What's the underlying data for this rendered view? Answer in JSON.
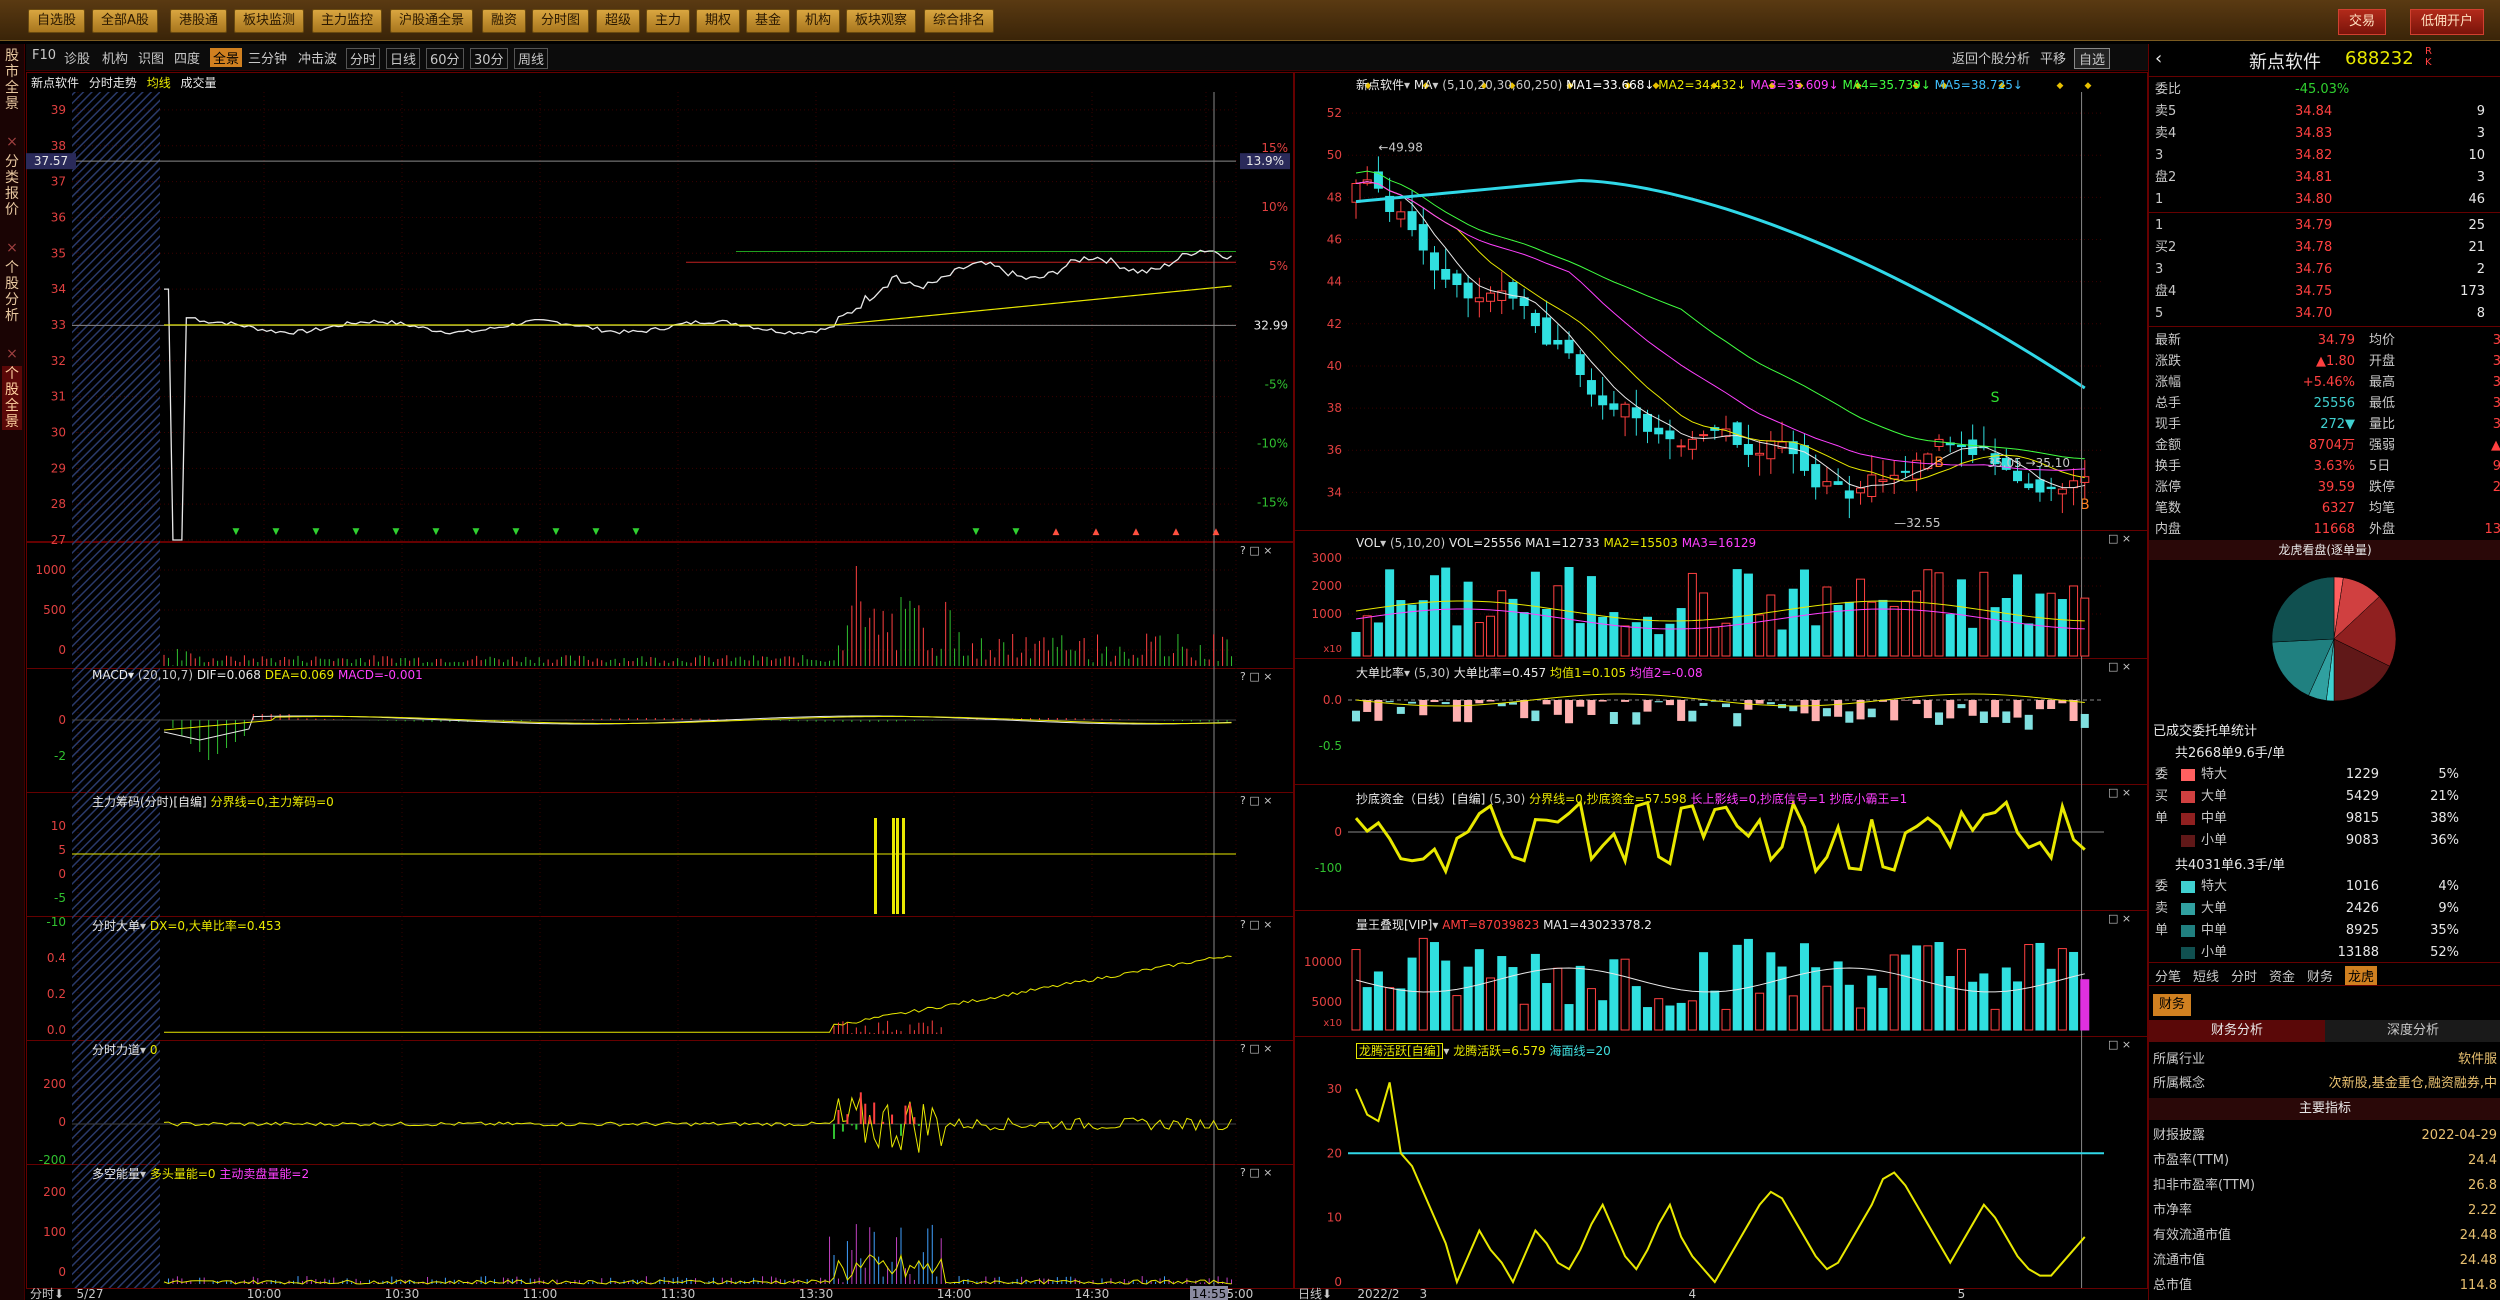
{
  "topbar": {
    "menu": [
      "自选股",
      "全部A股",
      "港股通",
      "板块监测",
      "主力监控",
      "沪股通全景",
      "融资",
      "分时图",
      "超级",
      "主力",
      "期权",
      "基金",
      "机构",
      "板块观察",
      "综合排名"
    ],
    "buttons": {
      "trade": "交易",
      "open_account": "低佣开户"
    },
    "window": [
      "–",
      "□",
      "×"
    ]
  },
  "left_tabs": [
    {
      "label": "股市全景",
      "close": "×"
    },
    {
      "label": "分类报价",
      "close": "×"
    },
    {
      "label": "个股分析",
      "close": "×"
    },
    {
      "label": "个股全景",
      "close": "×"
    }
  ],
  "toolbar": {
    "left": [
      "F10",
      "诊股",
      "机构",
      "识图",
      "四度"
    ],
    "active": "全景",
    "middle": [
      "三分钟",
      "冲击波"
    ],
    "periods": [
      "分时",
      "日线",
      "60分",
      "30分",
      "周线"
    ],
    "right": [
      "返回个股分析",
      "平移",
      "自选"
    ]
  },
  "intraday": {
    "title": {
      "name": "新点软件",
      "mode": "分时走势",
      "avg": "均线",
      "vol": "成交量"
    },
    "price_ticks": [
      "39",
      "38",
      "37",
      "36",
      "35",
      "34",
      "33",
      "32",
      "31",
      "30",
      "29",
      "28",
      "27"
    ],
    "pct_ticks": [
      "15%",
      "10%",
      "5%",
      "",
      "-5%",
      "-10%",
      "-15%"
    ],
    "current_price_label": "37.57",
    "current_pct_label": "13.9%",
    "ref_price": "32.99",
    "vol_ticks": [
      "1000",
      "500",
      "0"
    ],
    "time_ticks": [
      "5/27",
      "10:00",
      "10:30",
      "11:00",
      "11:30",
      "13:30",
      "14:00",
      "14:30",
      "14:55",
      "15:00"
    ],
    "time_label": "分时"
  },
  "macd_panel": {
    "name": "MACD",
    "params": "(20,10,7)",
    "dif": "DIF=0.068",
    "dea": "DEA=0.069",
    "macd": "MACD=-0.001",
    "ticks": [
      "0",
      "-2"
    ]
  },
  "main_chip": {
    "name": "主力筹码(分时)[自编]",
    "text": "分界线=0,主力筹码=0",
    "ticks": [
      "10",
      "5",
      "0",
      "-5",
      "-10"
    ]
  },
  "big_order": {
    "name": "分时大单",
    "text": "DX=0,大单比率=0.453",
    "ticks": [
      "0.4",
      "0.2",
      "0.0"
    ]
  },
  "force": {
    "name": "分时力道",
    "text": "0",
    "ticks": [
      "200",
      "0",
      "-200"
    ]
  },
  "energy": {
    "name": "多空能量",
    "a": "多头量能=0",
    "b": "主动卖盘量能=2",
    "ticks": [
      "200",
      "100",
      "0"
    ]
  },
  "kline": {
    "name": "新点软件",
    "ma_label": "MA",
    "params": "(5,10,20,30,60,250)",
    "ma": [
      {
        "t": "MA1=33.668",
        "c": "#ffffff"
      },
      {
        "t": "MA2=34.432",
        "c": "#e8e800"
      },
      {
        "t": "MA3=35.609",
        "c": "#ff40ff"
      },
      {
        "t": "MA4=35.739",
        "c": "#40ff40"
      },
      {
        "t": "MA5=38.725",
        "c": "#40c0ff"
      }
    ],
    "price_ticks": [
      "52",
      "50",
      "48",
      "46",
      "44",
      "42",
      "40",
      "38",
      "36",
      "34"
    ],
    "labels": {
      "high": "49.98",
      "low": "32.55",
      "mid": "35.05",
      "mid2": "35.10",
      "b1": "B",
      "s1": "S",
      "b2": "B"
    },
    "time_ticks": [
      "2022/2",
      "3",
      "4",
      "5"
    ],
    "time_label": "日线"
  },
  "vol_panel": {
    "name": "VOL",
    "params": "(5,10,20)",
    "vol": "VOL=25556",
    "ma1": "MA1=12733",
    "ma2": "MA2=15503",
    "ma3": "MA3=16129",
    "ticks": [
      "3000",
      "2000",
      "1000"
    ],
    "unit": "x10"
  },
  "big_ratio": {
    "name": "大单比率",
    "params": "(5,30)",
    "val": "大单比率=0.457",
    "m1": "均值1=0.105",
    "m2": "均值2=-0.08",
    "ticks": [
      "0.0",
      "-0.5"
    ]
  },
  "bottom_fund": {
    "name": "抄底资金（日线）[自编]",
    "params": "(5,30)",
    "text": "分界线=0,抄底资金=57.598",
    "t2": "长上影线=0,抄底信号=1",
    "t3": "抄底小霸王=1",
    "ticks": [
      "0",
      "-100"
    ]
  },
  "volume_king": {
    "name": "量王叠现[VIP]",
    "amt": "AMT=87039823",
    "ma1": "MA1=43023378.2",
    "ticks": [
      "10000",
      "5000"
    ],
    "unit": "x10"
  },
  "dragon": {
    "name": "龙腾活跃[自编]",
    "text": "龙腾活跃=6.579",
    "t2": "海面线=20",
    "ticks": [
      "30",
      "20",
      "10",
      "0"
    ]
  },
  "quote": {
    "name": "新点软件",
    "code": "688232",
    "flag": "R K",
    "ratio_label": "委比",
    "ratio_val": "-45.03%",
    "sell": [
      {
        "l": "卖5",
        "p": "34.84",
        "v": "9"
      },
      {
        "l": "卖4",
        "p": "34.83",
        "v": "3"
      },
      {
        "l": "3",
        "p": "34.82",
        "v": "10"
      },
      {
        "l": "盘2",
        "p": "34.81",
        "v": "3"
      },
      {
        "l": "1",
        "p": "34.80",
        "v": "46"
      }
    ],
    "buy": [
      {
        "l": "1",
        "p": "34.79",
        "v": "25"
      },
      {
        "l": "买2",
        "p": "34.78",
        "v": "21"
      },
      {
        "l": "3",
        "p": "34.76",
        "v": "2"
      },
      {
        "l": "盘4",
        "p": "34.75",
        "v": "173"
      },
      {
        "l": "5",
        "p": "34.70",
        "v": "8"
      }
    ],
    "stats": [
      {
        "a": "最新",
        "b": "34.79",
        "c": "均价",
        "d": "3"
      },
      {
        "a": "涨跌",
        "b": "▲1.80",
        "c": "开盘",
        "d": "3"
      },
      {
        "a": "涨幅",
        "b": "+5.46%",
        "c": "最高",
        "d": "3"
      },
      {
        "a": "总手",
        "b": "25556",
        "c": "最低",
        "d": "3"
      },
      {
        "a": "现手",
        "b": "272▼",
        "c": "量比",
        "d": "3"
      },
      {
        "a": "金额",
        "b": "8704万",
        "c": "强弱",
        "d": "▲"
      },
      {
        "a": "换手",
        "b": "3.63%",
        "c": "5日",
        "d": "9"
      },
      {
        "a": "涨停",
        "b": "39.59",
        "c": "跌停",
        "d": "2"
      },
      {
        "a": "笔数",
        "b": "6327",
        "c": "均笔",
        "d": ""
      },
      {
        "a": "内盘",
        "b": "11668",
        "c": "外盘",
        "d": "13"
      }
    ],
    "dragon_title": "龙虎看盘(逐单量)",
    "done_title": "已成交委托单统计",
    "total1": "共2668单9.6手/单",
    "buy_orders": [
      {
        "s": "委",
        "n": "特大",
        "v": "1229",
        "p": "5%",
        "c": "#ff6060"
      },
      {
        "s": "买",
        "n": "大单",
        "v": "5429",
        "p": "21%",
        "c": "#d04040"
      },
      {
        "s": "单",
        "n": "中单",
        "v": "9815",
        "p": "38%",
        "c": "#902020"
      },
      {
        "s": "",
        "n": "小单",
        "v": "9083",
        "p": "36%",
        "c": "#601818"
      }
    ],
    "total2": "共4031单6.3手/单",
    "sell_orders": [
      {
        "s": "委",
        "n": "特大",
        "v": "1016",
        "p": "4%",
        "c": "#40d0d0"
      },
      {
        "s": "卖",
        "n": "大单",
        "v": "2426",
        "p": "9%",
        "c": "#30a0a0"
      },
      {
        "s": "单",
        "n": "中单",
        "v": "8925",
        "p": "35%",
        "c": "#208080"
      },
      {
        "s": "",
        "n": "小单",
        "v": "13188",
        "p": "52%",
        "c": "#105050"
      }
    ],
    "tabs": [
      "分笔",
      "短线",
      "分时",
      "资金",
      "财务",
      "龙虎"
    ],
    "fin_tab": "财务",
    "fin_sub": [
      "财务分析",
      "深度分析"
    ],
    "industry": {
      "k": "所属行业",
      "v": "软件服"
    },
    "concept": {
      "k": "所属概念",
      "v": "次新股,基金重仓,融资融券,中"
    },
    "main_idx": "主要指标",
    "fin": [
      {
        "k": "财报披露",
        "v": "2022-04-29"
      },
      {
        "k": "市盈率(TTM)",
        "v": "24.4"
      },
      {
        "k": "扣非市盈率(TTM)",
        "v": "26.8"
      },
      {
        "k": "市净率",
        "v": "2.22"
      },
      {
        "k": "有效流通市值",
        "v": "24.48"
      },
      {
        "k": "流通市值",
        "v": "24.48"
      },
      {
        "k": "总市值",
        "v": "114.8"
      }
    ]
  }
}
